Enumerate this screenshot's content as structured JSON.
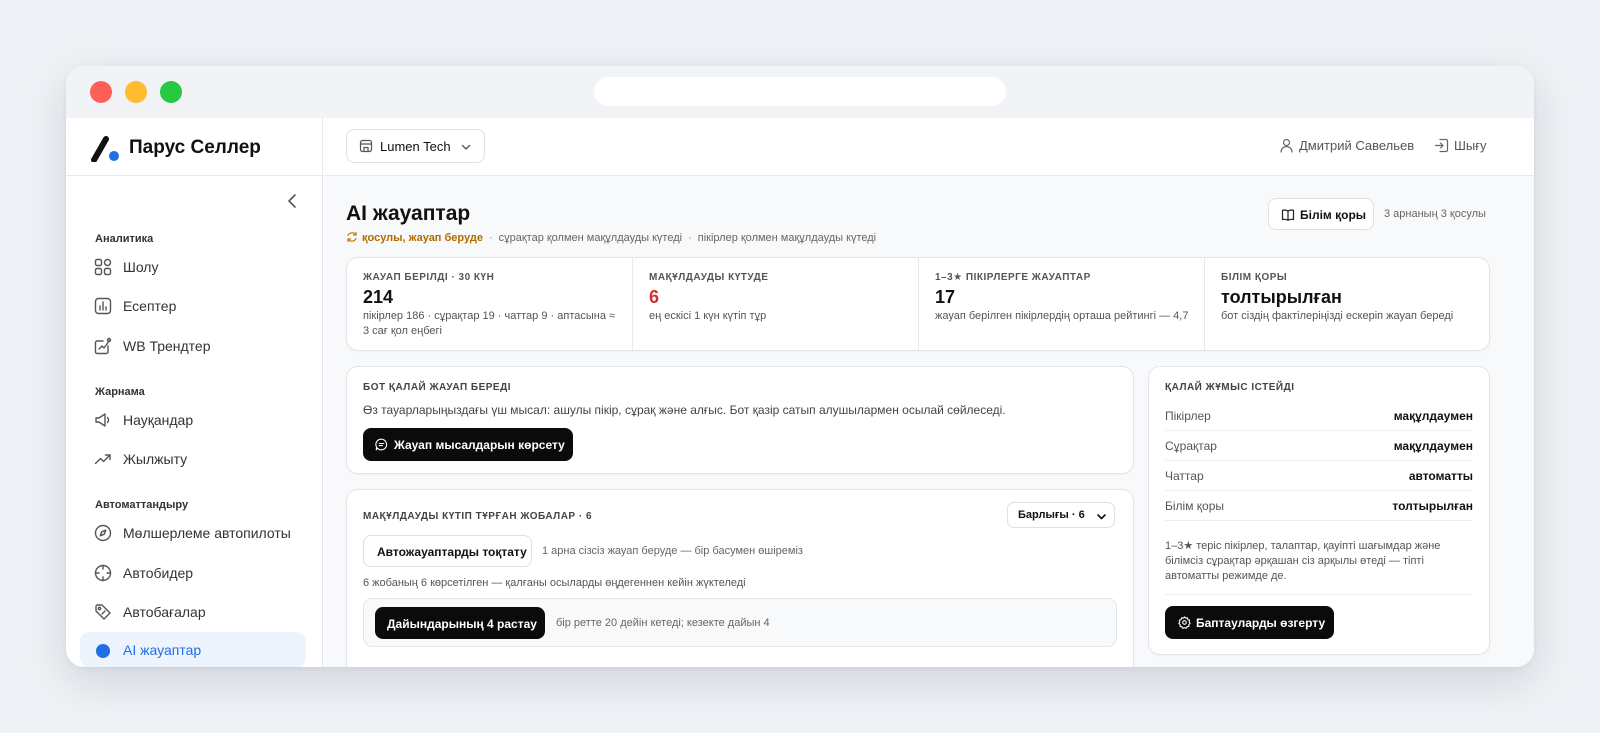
{
  "app": {
    "name": "Парус Селлер"
  },
  "store_select": {
    "label": "Lumen Tech"
  },
  "user": {
    "name": "Дмитрий Савельев",
    "logout": "Шығу"
  },
  "sidebar": {
    "groups": [
      {
        "title": "Аналитика",
        "items": [
          "Шолу",
          "Есептер",
          "WB Трендтер"
        ]
      },
      {
        "title": "Жарнама",
        "items": [
          "Науқандар",
          "Жылжыту"
        ]
      },
      {
        "title": "Автоматтандыру",
        "items": [
          "Мөлшерлеме автопилоты",
          "Автобидер",
          "Автобағалар",
          "AI жауаптар"
        ]
      }
    ],
    "icons": [
      "grid-icon",
      "chart-icon",
      "trend-card-icon",
      "megaphone-icon",
      "trending-up-icon",
      "compass-icon",
      "crosshair-icon",
      "tag-icon",
      "ai-dot-icon"
    ],
    "active_item": "AI жауаптар",
    "accent": "#1f6fe5"
  },
  "page": {
    "title": "AI жауаптар",
    "status": "қосулы, жауап беруде",
    "status_notes": [
      "сұрақтар қолмен мақұлдауды күтеді",
      "пікірлер қолмен мақұлдауды күтеді"
    ],
    "kb_button": "Білім қоры",
    "kb_note": "3 арнаның 3 қосулы"
  },
  "stats": [
    {
      "label": "ЖАУАП БЕРІЛДІ · 30 КҮН",
      "value": "214",
      "desc": "пікірлер 186 · сұрақтар 19 · чаттар 9 · аптасына ≈ 3 сағ қол еңбегі"
    },
    {
      "label": "МАҚҰЛДАУДЫ КҮТУДЕ",
      "value": "6",
      "desc": "ең ескісі 1 күн күтіп тұр",
      "value_color": "#d32f2f"
    },
    {
      "label": "1–3★ ПІКІРЛЕРГЕ ЖАУАПТАР",
      "value": "17",
      "desc": "жауап берілген пікірлердің орташа рейтингі — 4,7"
    },
    {
      "label": "БІЛІМ ҚОРЫ",
      "value": "толтырылған",
      "desc": "бот сіздің фактілеріңізді ескеріп жауап береді"
    }
  ],
  "bot_card": {
    "title": "БОТ ҚАЛАЙ ЖАУАП БЕРЕДІ",
    "text": "Өз тауарларыңыздағы үш мысал: ашулы пікір, сұрақ және алғыс. Бот қазір сатып алушылармен осылай сөйлеседі.",
    "button": "Жауап мысалдарын көрсету"
  },
  "drafts_card": {
    "title": "МАҚҰЛДАУДЫ КҮТІП ТҰРҒАН ЖОБАЛАР · 6",
    "filter": "Барлығы · 6",
    "stop_button": "Автожауаптарды тоқтату",
    "stop_note": "1 арна сізсіз жауап беруде — бір басумен өшіреміз",
    "shown_note": "6 жобаның 6 көрсетілген — қалғаны осыларды өңдегеннен кейін жүктеледі",
    "approve_button": "Дайындарының 4 растау",
    "approve_note": "бір ретте 20 дейін кетеді; кезекте дайын 4"
  },
  "how_card": {
    "title": "ҚАЛАЙ ЖҰМЫС ІСТЕЙДІ",
    "rows": [
      {
        "k": "Пікірлер",
        "v": "мақұлдаумен"
      },
      {
        "k": "Сұрақтар",
        "v": "мақұлдаумен"
      },
      {
        "k": "Чаттар",
        "v": "автоматты"
      },
      {
        "k": "Білім қоры",
        "v": "толтырылған"
      }
    ],
    "note": "1–3★ теріс пікірлер, талаптар, қауіпті шағымдар және білімсіз сұрақтар әрқашан сіз арқылы өтеді — тіпті автоматты режимде де.",
    "button": "Баптауларды өзгерту"
  }
}
